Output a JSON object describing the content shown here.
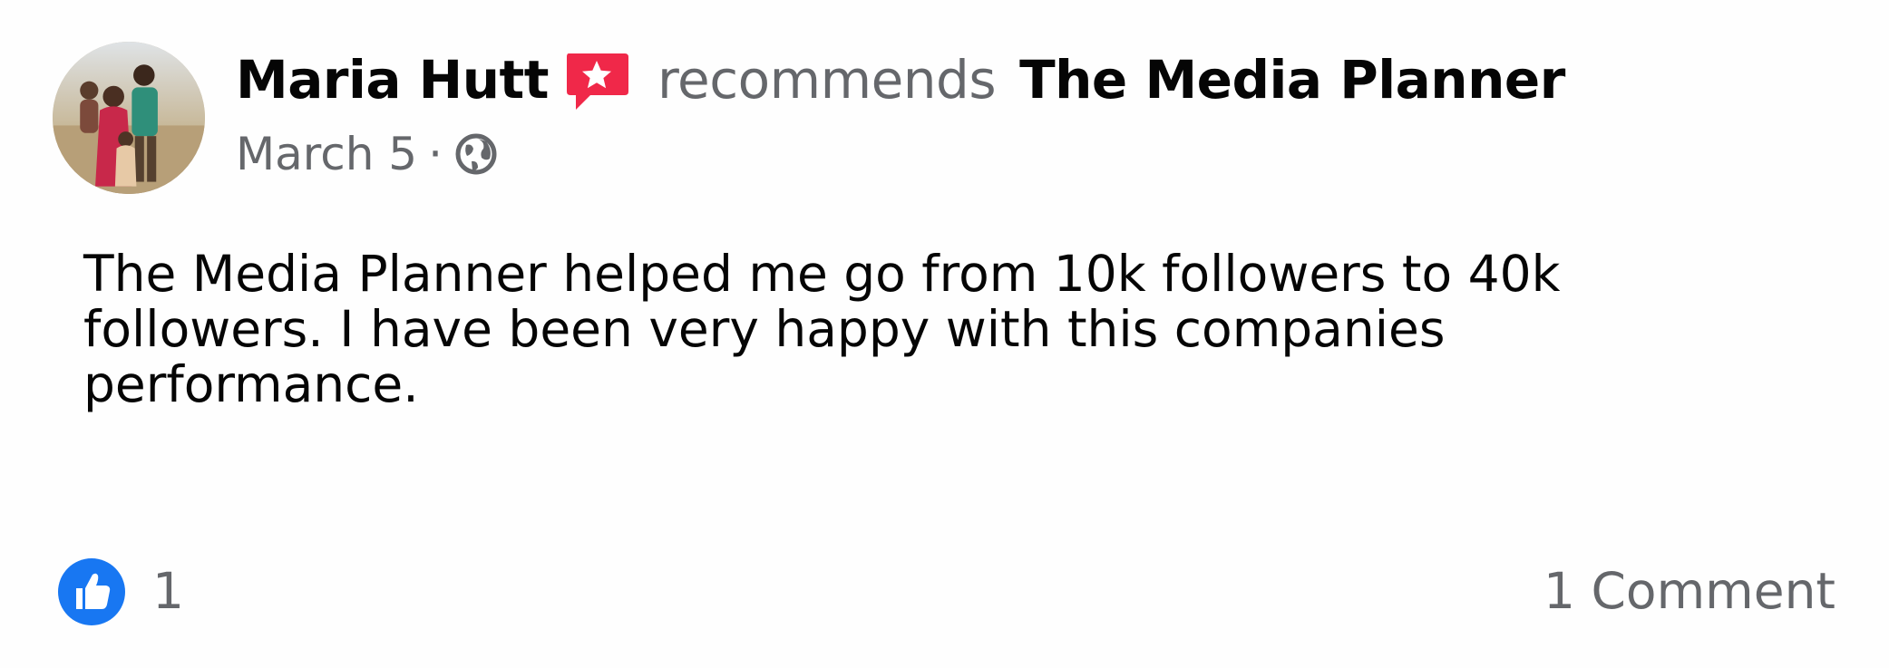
{
  "post": {
    "author": "Maria Hutt",
    "action": "recommends",
    "page_name": "The Media Planner",
    "date": "March 5",
    "separator": "·",
    "privacy_icon": "globe-icon",
    "recommend_icon": "recommendation-star-icon",
    "body": "The Media Planner helped me go from 10k followers to 40k followers. I have been very happy with this companies performance.",
    "reactions": {
      "icon": "like-icon",
      "count": "1"
    },
    "comments_label": "1 Comment"
  },
  "colors": {
    "primary_text": "#050505",
    "secondary_text": "#65676b",
    "like_blue": "#1877f2",
    "recommend_red": "#f02849"
  }
}
